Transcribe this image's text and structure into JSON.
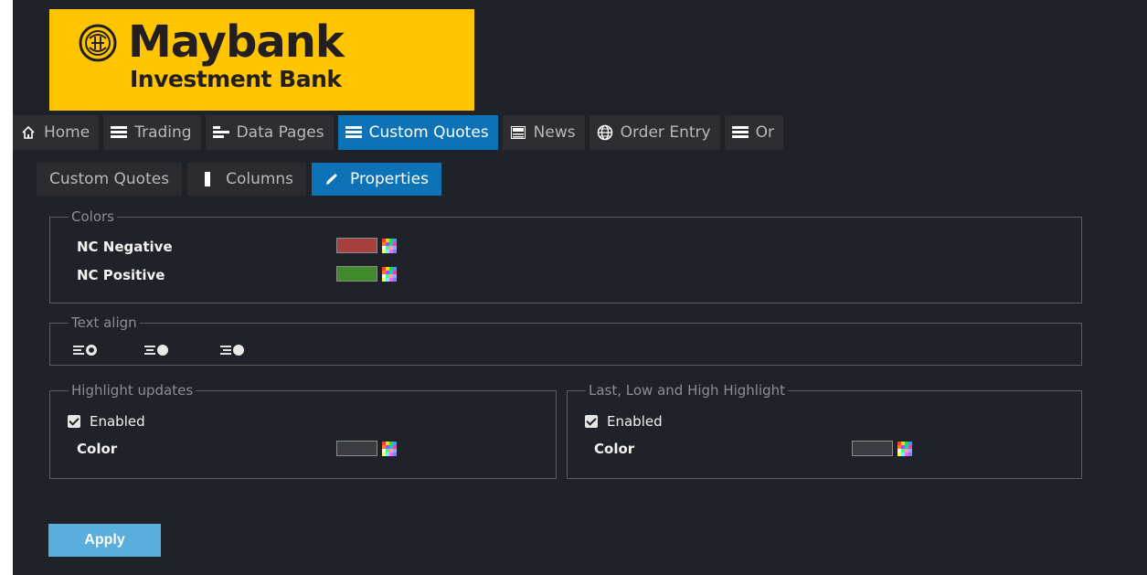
{
  "logo": {
    "brand": "Maybank",
    "sub": "Investment Bank"
  },
  "nav": {
    "items": [
      {
        "label": "Home",
        "icon": "home-icon"
      },
      {
        "label": "Trading",
        "icon": "list-icon"
      },
      {
        "label": "Data Pages",
        "icon": "bars-icon"
      },
      {
        "label": "Custom Quotes",
        "icon": "list-icon",
        "active": true
      },
      {
        "label": "News",
        "icon": "newspaper-icon"
      },
      {
        "label": "Order Entry",
        "icon": "globe-icon"
      },
      {
        "label": "Or",
        "icon": "list-icon"
      }
    ]
  },
  "subtabs": {
    "custom_quotes": "Custom Quotes",
    "columns": "Columns",
    "properties": "Properties"
  },
  "colors": {
    "legend": "Colors",
    "nc_negative_label": "NC Negative",
    "nc_negative_color": "#a84040",
    "nc_positive_label": "NC Positive",
    "nc_positive_color": "#3f8a2b"
  },
  "text_align": {
    "legend": "Text align",
    "selected": "left"
  },
  "highlight_updates": {
    "legend": "Highlight updates",
    "enabled_label": "Enabled",
    "color_label": "Color",
    "color": "#3a3c41"
  },
  "llh_highlight": {
    "legend": "Last, Low and High Highlight",
    "enabled_label": "Enabled",
    "color_label": "Color",
    "color": "#3a3c41"
  },
  "apply_label": "Apply"
}
